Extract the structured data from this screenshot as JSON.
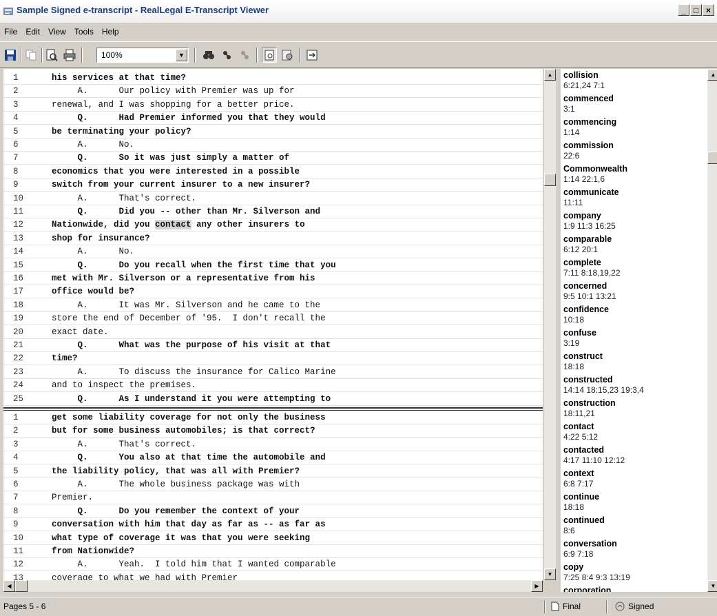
{
  "window": {
    "title": "Sample Signed e-transcript - RealLegal E-Transcript Viewer"
  },
  "menu": [
    "File",
    "Edit",
    "View",
    "Tools",
    "Help"
  ],
  "toolbar": {
    "zoom": "100%"
  },
  "transcript_top": [
    {
      "n": "1",
      "t": "his services at that time?",
      "q": true
    },
    {
      "n": "2",
      "t": "     A.      Our policy with Premier was up for",
      "q": false
    },
    {
      "n": "3",
      "t": "renewal, and I was shopping for a better price.",
      "q": false
    },
    {
      "n": "4",
      "t": "     Q.      Had Premier informed you that they would",
      "q": true
    },
    {
      "n": "5",
      "t": "be terminating your policy?",
      "q": true
    },
    {
      "n": "6",
      "t": "     A.      No.",
      "q": false
    },
    {
      "n": "7",
      "t": "     Q.      So it was just simply a matter of",
      "q": true
    },
    {
      "n": "8",
      "t": "economics that you were interested in a possible",
      "q": true
    },
    {
      "n": "9",
      "t": "switch from your current insurer to a new insurer?",
      "q": true
    },
    {
      "n": "10",
      "t": "     A.      That's correct.",
      "q": false
    },
    {
      "n": "11",
      "t": "     Q.      Did you -- other than Mr. Silverson and",
      "q": true
    },
    {
      "n": "12",
      "t": "Nationwide, did you contact any other insurers to",
      "q": true
    },
    {
      "n": "13",
      "t": "shop for insurance?",
      "q": true
    },
    {
      "n": "14",
      "t": "     A.      No.",
      "q": false
    },
    {
      "n": "15",
      "t": "     Q.      Do you recall when the first time that you",
      "q": true
    },
    {
      "n": "16",
      "t": "met with Mr. Silverson or a representative from his",
      "q": true
    },
    {
      "n": "17",
      "t": "office would be?",
      "q": true
    },
    {
      "n": "18",
      "t": "     A.      It was Mr. Silverson and he came to the",
      "q": false
    },
    {
      "n": "19",
      "t": "store the end of December of '95.  I don't recall the",
      "q": false
    },
    {
      "n": "20",
      "t": "exact date.",
      "q": false
    },
    {
      "n": "21",
      "t": "     Q.      What was the purpose of his visit at that",
      "q": true
    },
    {
      "n": "22",
      "t": "time?",
      "q": true
    },
    {
      "n": "23",
      "t": "     A.      To discuss the insurance for Calico Marine",
      "q": false
    },
    {
      "n": "24",
      "t": "and to inspect the premises.",
      "q": false
    },
    {
      "n": "25",
      "t": "     Q.      As I understand it you were attempting to",
      "q": true
    }
  ],
  "highlight": {
    "line": "12",
    "before": "Nationwide, did you ",
    "word": "contact",
    "after": " any other insurers to"
  },
  "transcript_bottom": [
    {
      "n": "1",
      "t": "get some liability coverage for not only the business",
      "q": true
    },
    {
      "n": "2",
      "t": "but for some business automobiles; is that correct?",
      "q": true
    },
    {
      "n": "3",
      "t": "     A.      That's correct.",
      "q": false
    },
    {
      "n": "4",
      "t": "     Q.      You also at that time the automobile and",
      "q": true
    },
    {
      "n": "5",
      "t": "the liability policy, that was all with Premier?",
      "q": true
    },
    {
      "n": "6",
      "t": "     A.      The whole business package was with",
      "q": false
    },
    {
      "n": "7",
      "t": "Premier.",
      "q": false
    },
    {
      "n": "8",
      "t": "     Q.      Do you remember the context of your",
      "q": true
    },
    {
      "n": "9",
      "t": "conversation with him that day as far as -- as far as",
      "q": true
    },
    {
      "n": "10",
      "t": "what type of coverage it was that you were seeking",
      "q": true
    },
    {
      "n": "11",
      "t": "from Nationwide?",
      "q": true
    },
    {
      "n": "12",
      "t": "     A.      Yeah.  I told him that I wanted comparable",
      "q": false
    },
    {
      "n": "13",
      "t": "coverage to what we had with Premier",
      "q": false
    }
  ],
  "word_index": [
    {
      "w": "collision",
      "r": "6:21,24 7:1"
    },
    {
      "w": "commenced",
      "r": "3:1"
    },
    {
      "w": "commencing",
      "r": "1:14"
    },
    {
      "w": "commission",
      "r": "22:6"
    },
    {
      "w": "Commonwealth",
      "r": "1:14 22:1,6"
    },
    {
      "w": "communicate",
      "r": "11:11"
    },
    {
      "w": "company",
      "r": "1:9 11:3 16:25"
    },
    {
      "w": "comparable",
      "r": "6:12 20:1"
    },
    {
      "w": "complete",
      "r": "7:11 8:18,19,22"
    },
    {
      "w": "concerned",
      "r": "9:5 10:1 13:21"
    },
    {
      "w": "confidence",
      "r": "10:18"
    },
    {
      "w": "confuse",
      "r": "3:19"
    },
    {
      "w": "construct",
      "r": "18:18"
    },
    {
      "w": "constructed",
      "r": "14:14 18:15,23 19:3,4"
    },
    {
      "w": "construction",
      "r": "18:11,21"
    },
    {
      "w": "contact",
      "r": "4:22 5:12"
    },
    {
      "w": "contacted",
      "r": "4:17 11:10 12:12"
    },
    {
      "w": "context",
      "r": "6:8 7:17"
    },
    {
      "w": "continue",
      "r": "18:18"
    },
    {
      "w": "continued",
      "r": "8:6"
    },
    {
      "w": "conversation",
      "r": "6:9 7:18"
    },
    {
      "w": "copy",
      "r": "7:25 8:4 9:3 13:19"
    },
    {
      "w": "corporation",
      "r": ""
    }
  ],
  "status": {
    "pages": "Pages 5 - 6",
    "final": "Final",
    "signed": "Signed"
  },
  "icons": [
    "app-icon",
    "save-icon",
    "copy-icon",
    "print-preview-icon",
    "print-icon",
    "find-icon",
    "find-next-icon",
    "find-prev-icon",
    "page-view-icon",
    "settings-icon",
    "export-icon",
    "final-icon",
    "signed-icon"
  ]
}
